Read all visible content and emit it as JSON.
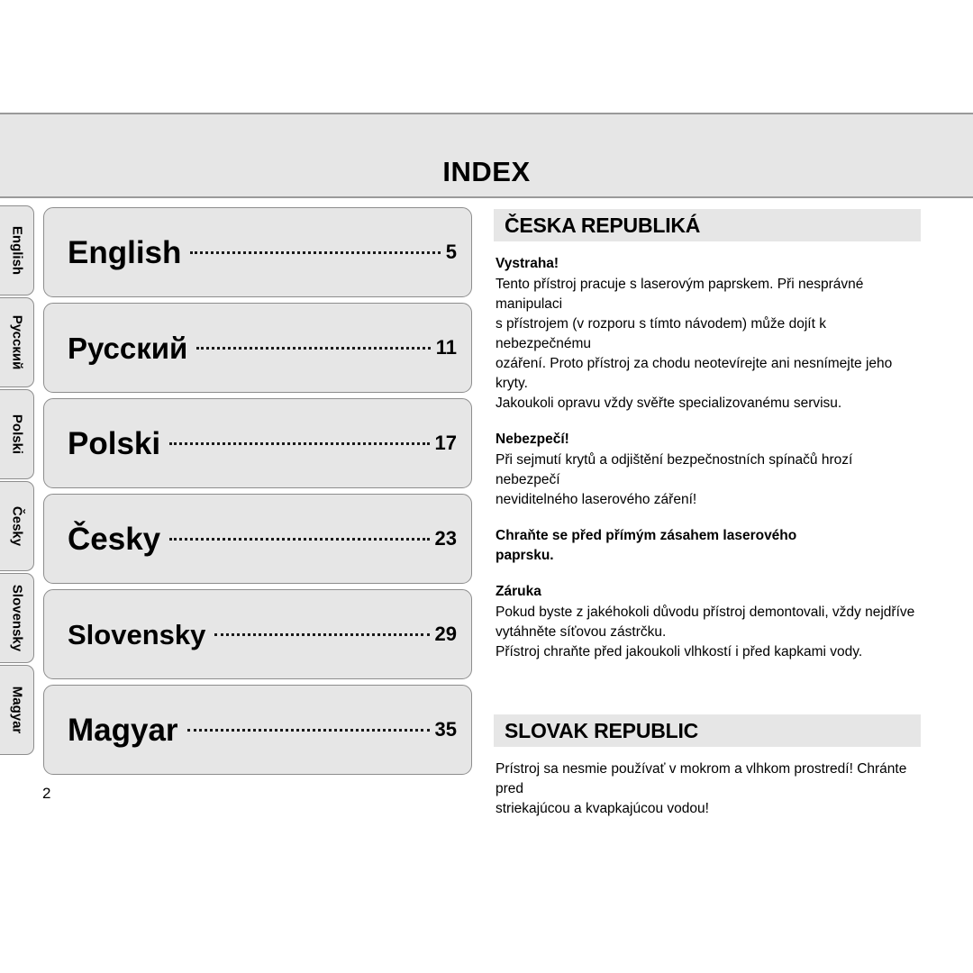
{
  "header": {
    "title": "INDEX"
  },
  "colors": {
    "panel_gray": "#e6e6e6",
    "border_gray": "#8d8d8d",
    "band_border": "#9a9a9a",
    "text": "#000000"
  },
  "side_tabs": [
    {
      "label": "English"
    },
    {
      "label": "Русский"
    },
    {
      "label": "Polski"
    },
    {
      "label": "Česky"
    },
    {
      "label": "Slovensky"
    },
    {
      "label": "Magyar"
    }
  ],
  "index": {
    "rows": [
      {
        "language": "English",
        "page": "5"
      },
      {
        "language": "Русский",
        "page": "11"
      },
      {
        "language": "Polski",
        "page": "17"
      },
      {
        "language": "Česky",
        "page": "23"
      },
      {
        "language": "Slovensky",
        "page": "29"
      },
      {
        "language": "Magyar",
        "page": "35"
      }
    ]
  },
  "folio": "2",
  "sections": [
    {
      "bar_title": "ČESKA REPUBLIKÁ",
      "blocks": [
        {
          "heading": "Vystraha!",
          "lines": [
            "Tento přístroj pracuje s laserovým paprskem. Při nesprávné manipulaci",
            "s přístrojem (v rozporu s tímto návodem) může dojít k nebezpečnému",
            "ozáření. Proto přístroj za chodu neotevírejte ani nesnímejte jeho kryty.",
            "Jakoukoli opravu vždy svěřte specializovanému servisu."
          ]
        },
        {
          "heading": "Nebezpečí!",
          "lines": [
            "Při sejmutí krytů a odjištění bezpečnostních spínačů hrozí nebezpečí",
            "neviditelného laserového záření!"
          ]
        },
        {
          "heading": "Chraňte se před přímým zásahem laserového\npaprsku.",
          "lines": []
        },
        {
          "heading": "Záruka",
          "lines": [
            "Pokud byste z jakéhokoli důvodu přístroj demontovali, vždy nejdříve",
            "vytáhněte síťovou zástrčku.",
            "Přístroj chraňte před jakoukoli vlhkostí i před kapkami vody."
          ]
        }
      ]
    },
    {
      "bar_title": "SLOVAK REPUBLIC",
      "blocks": [
        {
          "heading": "",
          "lines": [
            "Prístroj sa nesmie používať v mokrom a vlhkom prostredí! Chránte pred",
            "striekajúcou a kvapkajúcou vodou!"
          ]
        }
      ]
    }
  ]
}
